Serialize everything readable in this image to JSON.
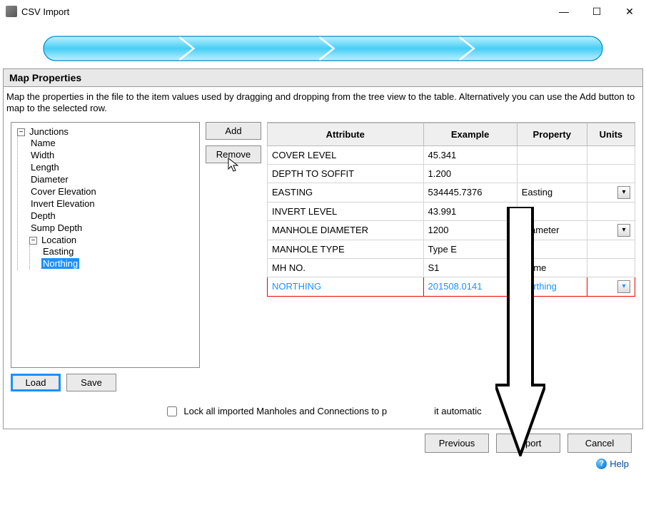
{
  "window": {
    "title": "CSV Import",
    "min": "—",
    "max": "☐",
    "close": "✕"
  },
  "panel": {
    "header": "Map Properties",
    "desc": "Map the properties in the file to the item values used by dragging and dropping from the tree view to the table. Alternatively you can use the Add button to map to the selected row."
  },
  "tree": {
    "root": "Junctions",
    "items": [
      "Name",
      "Width",
      "Length",
      "Diameter",
      "Cover Elevation",
      "Invert Elevation",
      "Depth",
      "Sump Depth"
    ],
    "location_label": "Location",
    "location_children": [
      "Easting",
      "Northing"
    ],
    "selected": "Northing"
  },
  "buttons": {
    "add": "Add",
    "remove": "Remove",
    "load": "Load",
    "save": "Save",
    "previous": "Previous",
    "import": "Import",
    "cancel": "Cancel",
    "help": "Help"
  },
  "table": {
    "headers": {
      "attribute": "Attribute",
      "example": "Example",
      "property": "Property",
      "units": "Units"
    },
    "rows": [
      {
        "attribute": "COVER LEVEL",
        "example": "45.341",
        "property": "",
        "units_dd": false
      },
      {
        "attribute": "DEPTH TO SOFFIT",
        "example": "1.200",
        "property": "",
        "units_dd": false
      },
      {
        "attribute": "EASTING",
        "example": "534445.7376",
        "property": "Easting",
        "units_dd": true
      },
      {
        "attribute": "INVERT LEVEL",
        "example": "43.991",
        "property": "",
        "units_dd": false
      },
      {
        "attribute": "MANHOLE DIAMETER",
        "example": "1200",
        "property": "Diameter",
        "units_dd": true
      },
      {
        "attribute": "MANHOLE TYPE",
        "example": "Type E",
        "property": "",
        "units_dd": false
      },
      {
        "attribute": "MH NO.",
        "example": "S1",
        "property": "Name",
        "units_dd": false
      },
      {
        "attribute": "NORTHING",
        "example": "201508.0141",
        "property": "Northing",
        "units_dd": true
      }
    ],
    "highlight_row": 7
  },
  "lock": {
    "label_before": "Lock all imported Manholes and Connections to p",
    "label_after": "it automatic",
    "checked": false
  }
}
